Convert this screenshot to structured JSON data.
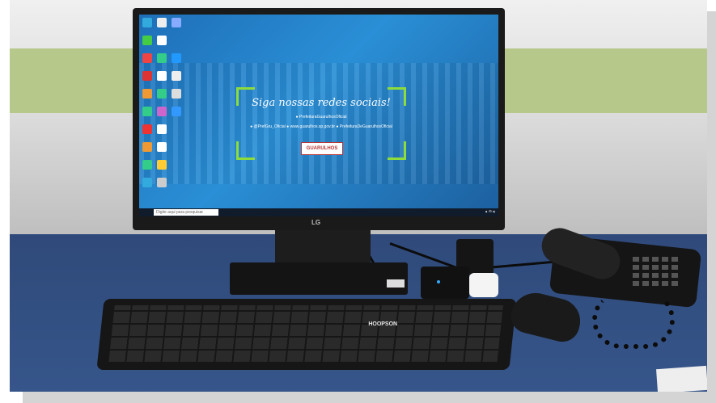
{
  "screen": {
    "headline": "Siga nossas redes sociais!",
    "facebook_handle": "PrefeituraGuarulhosOficial",
    "twitter_handle": "@PrefGru_Oficial",
    "website": "www.guarulhos.sp.gov.br",
    "instagram_handle": "PrefeituraDeGuarulhosOficial",
    "logo_text": "GUARULHOS",
    "search_placeholder": "Digite aqui para pesquisar"
  },
  "monitor": {
    "brand": "LG"
  },
  "keyboard": {
    "brand": "HOOPSON"
  },
  "colors": {
    "screen_blue": "#2a8fd6",
    "accent_green": "#8ddc3c",
    "desk_blue": "#34528a"
  }
}
